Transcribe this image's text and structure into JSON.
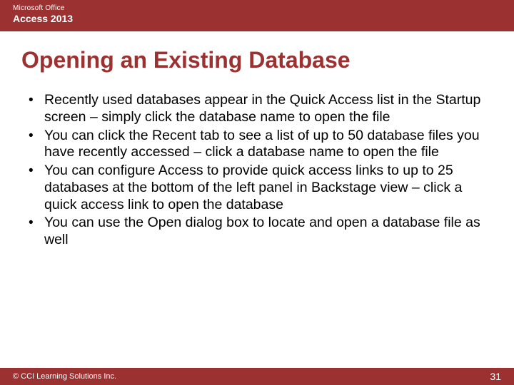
{
  "header": {
    "brand": "Microsoft Office",
    "product": "Access 2013"
  },
  "title": "Opening an Existing Database",
  "bullets": [
    "Recently used databases appear in the Quick Access list in the Startup screen – simply click the database name to open the file",
    "You can click the Recent tab to see a list of up to 50 database files you have recently accessed – click a database name to open the file",
    "You can configure Access to provide quick access links to up to 25 databases at the bottom of the left panel in Backstage view – click a quick access link to open the database",
    "You can use the Open dialog box to locate and open a database file as well"
  ],
  "footer": {
    "copyright": "© CCI Learning Solutions Inc.",
    "page": "31"
  }
}
